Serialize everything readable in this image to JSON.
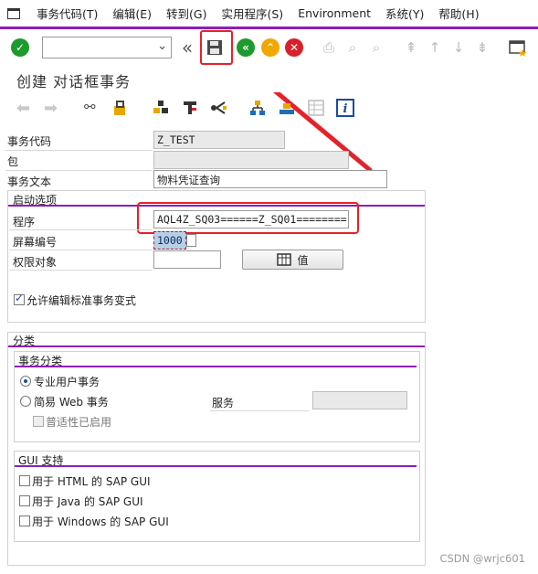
{
  "menu": {
    "items": [
      "事务代码(T)",
      "编辑(E)",
      "转到(G)",
      "实用程序(S)",
      "Environment",
      "系统(Y)",
      "帮助(H)"
    ]
  },
  "toolbar": {
    "command_field_value": "",
    "icons": [
      "enter-icon",
      "back-double-chevron-icon",
      "save-icon",
      "back-icon",
      "exit-icon",
      "cancel-icon",
      "print-icon",
      "find-icon",
      "find-next-icon",
      "first-page-icon",
      "previous-page-icon",
      "next-page-icon",
      "last-page-icon",
      "new-session-icon"
    ]
  },
  "screen": {
    "title": "创建 对话框事务"
  },
  "header_fields": {
    "tcode_label": "事务代码",
    "tcode_value": "Z_TEST",
    "package_label": "包",
    "package_value": "",
    "text_label": "事务文本",
    "text_value": "物料凭证查询"
  },
  "start_options": {
    "title": "启动选项",
    "program_label": "程序",
    "program_value": "AQL4Z_SQ03======Z_SQ01========",
    "screen_label": "屏幕编号",
    "screen_value": "1000",
    "auth_label": "权限对象",
    "auth_value": "",
    "values_button": "值",
    "allow_variant_label": "允许编辑标准事务变式",
    "allow_variant_checked": true
  },
  "classification": {
    "title": "分类",
    "tx_class_title": "事务分类",
    "professional_label": "专业用户事务",
    "easy_web_label": "简易 Web 事务",
    "service_label": "服务",
    "service_value": "",
    "pervasive_label": "普适性已启用"
  },
  "gui_support": {
    "title": "GUI 支持",
    "html_label": "用于 HTML 的 SAP GUI",
    "java_label": "用于 Java 的 SAP GUI",
    "windows_label": "用于 Windows 的 SAP GUI"
  },
  "watermark": "CSDN @wrjc601",
  "colors": {
    "accent_purple": "#8f1db8",
    "annotation_red": "#e4222a",
    "enter_green": "#1f9a2e",
    "back_green": "#1f9a2e",
    "exit_yellow": "#f0a800",
    "cancel_red": "#d8202a"
  }
}
